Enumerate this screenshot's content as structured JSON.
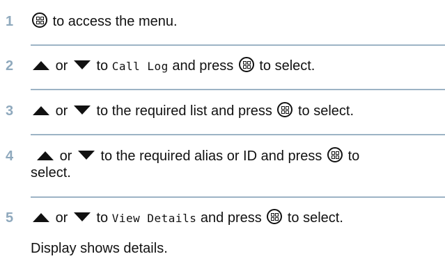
{
  "steps": [
    {
      "number": "1",
      "parts": {
        "after_menu": "to access the menu."
      }
    },
    {
      "number": "2",
      "parts": {
        "or": "or",
        "to": "to",
        "target": "Call Log",
        "press": "and press",
        "select": "to select."
      }
    },
    {
      "number": "3",
      "parts": {
        "or": "or",
        "to": "to the required list and press",
        "select": "to select."
      }
    },
    {
      "number": "4",
      "parts": {
        "or": "or",
        "to": "to the required alias or ID and press",
        "select_to": "to",
        "select_rest": "select."
      }
    },
    {
      "number": "5",
      "parts": {
        "or": "or",
        "to": "to",
        "target": "View Details",
        "press": "and press",
        "select": "to select."
      }
    }
  ],
  "result": "Display shows details.",
  "colors": {
    "step_number": "#8fa9bd",
    "separator": "#9cb3c5",
    "text": "#111111"
  },
  "icons": {
    "menu_button": "menu-ok-button-icon",
    "up": "up-arrow-icon",
    "down": "down-arrow-icon"
  }
}
